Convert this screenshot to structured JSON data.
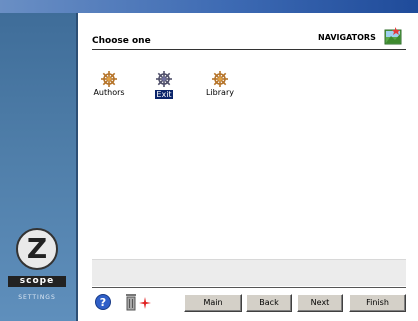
{
  "header": {
    "title": "Choose one",
    "section": "NAVIGATORS",
    "section_icon": "navigator-image-icon"
  },
  "items": [
    {
      "label": "Authors",
      "icon": "ship-wheel-icon",
      "selected": false
    },
    {
      "label": "Exit",
      "icon": "ship-wheel-icon",
      "selected": true
    },
    {
      "label": "Library",
      "icon": "ship-wheel-icon",
      "selected": false
    }
  ],
  "branding": {
    "logo_letter": "Z",
    "logo_band": "scope",
    "subtitle": "SETTINGS"
  },
  "toolbar": {
    "help_icon": "help-icon",
    "trash_icon": "trash-icon",
    "star_icon": "sparkle-icon",
    "main_label": "Main",
    "back_label": "Back",
    "next_label": "Next",
    "finish_label": "Finish"
  },
  "colors": {
    "sidebar": "#4f7ea9",
    "selection": "#0a246a",
    "button_face": "#d4d0c8",
    "title_bar": "#1f4b9a"
  }
}
